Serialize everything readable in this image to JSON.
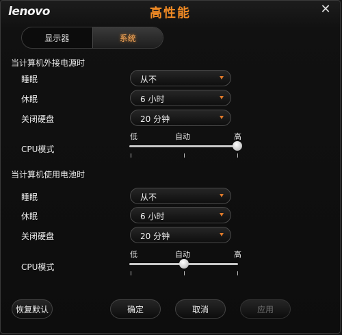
{
  "app": {
    "logo": "lenovo",
    "title": "高性能",
    "close_glyph": "✕"
  },
  "tabs": [
    {
      "label": "显示器",
      "active": false
    },
    {
      "label": "系统",
      "active": true
    }
  ],
  "ac": {
    "heading": "当计算机外接电源时",
    "sleep": {
      "label": "睡眠",
      "value": "从不"
    },
    "hibernate": {
      "label": "休眠",
      "value": "6 小时"
    },
    "disk": {
      "label": "关闭硬盘",
      "value": "20 分钟"
    },
    "cpu": {
      "label": "CPU模式",
      "low": "低",
      "auto": "自动",
      "high": "高",
      "level": 1.0
    }
  },
  "battery": {
    "heading": "当计算机使用电池时",
    "sleep": {
      "label": "睡眠",
      "value": "从不"
    },
    "hibernate": {
      "label": "休眠",
      "value": "6 小时"
    },
    "disk": {
      "label": "关闭硬盘",
      "value": "20 分钟"
    },
    "cpu": {
      "label": "CPU模式",
      "low": "低",
      "auto": "自动",
      "high": "高",
      "level": 0.5
    }
  },
  "buttons": {
    "restore": "恢复默认",
    "ok": "确定",
    "cancel": "取消",
    "apply": "应用"
  },
  "colors": {
    "accent": "#f08a24",
    "background": "#111111"
  }
}
